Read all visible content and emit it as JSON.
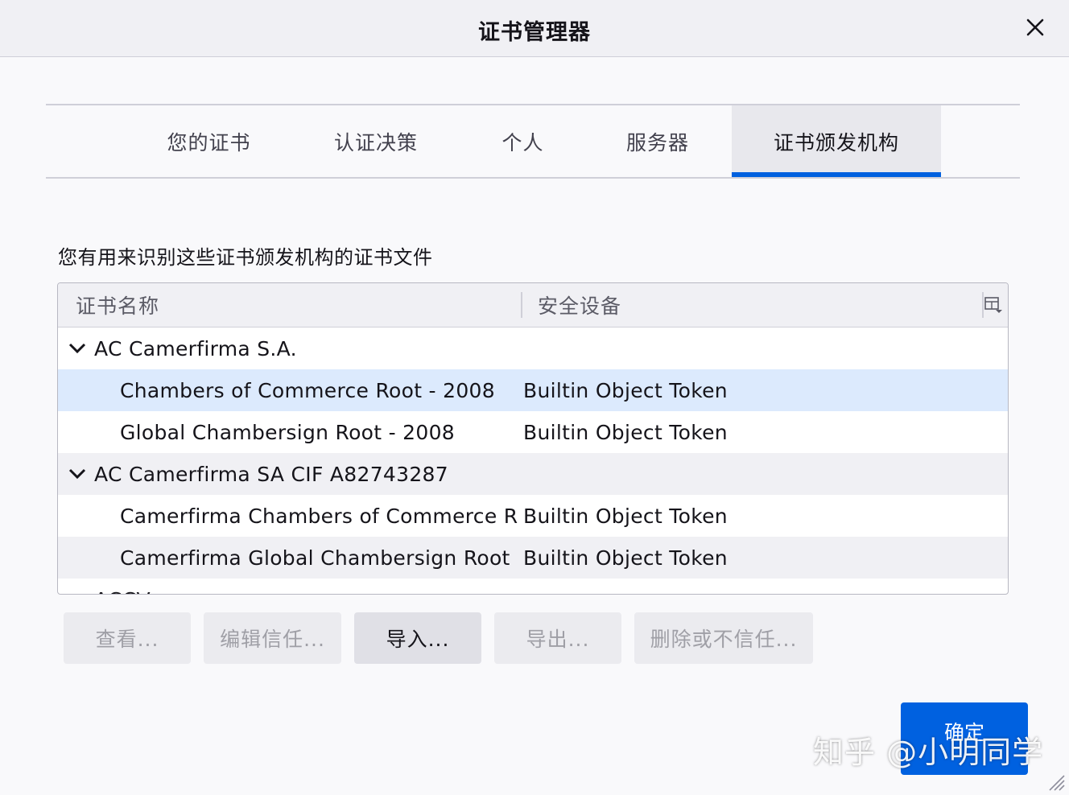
{
  "window": {
    "title": "证书管理器"
  },
  "tabs": [
    {
      "label": "您的证书"
    },
    {
      "label": "认证决策"
    },
    {
      "label": "个人"
    },
    {
      "label": "服务器"
    },
    {
      "label": "证书颁发机构",
      "active": true
    }
  ],
  "description": "您有用来识别这些证书颁发机构的证书文件",
  "tree": {
    "columns": [
      "证书名称",
      "安全设备"
    ],
    "rows": [
      {
        "name": "AC Camerfirma S.A.",
        "device": "",
        "group": true
      },
      {
        "name": "Chambers of Commerce Root - 2008",
        "device": "Builtin Object Token"
      },
      {
        "name": "Global Chambersign Root - 2008",
        "device": "Builtin Object Token"
      },
      {
        "name": "AC Camerfirma SA CIF A82743287",
        "device": "",
        "group": true
      },
      {
        "name": "Camerfirma Chambers of Commerce R...",
        "device": "Builtin Object Token"
      },
      {
        "name": "Camerfirma Global Chambersign Root",
        "device": "Builtin Object Token"
      },
      {
        "name": "ACCV",
        "device": "",
        "group": true
      }
    ]
  },
  "buttons": {
    "view": "查看...",
    "edit_trust": "编辑信任...",
    "import": "导入...",
    "export": "导出...",
    "delete": "删除或不信任..."
  },
  "ok_button": "确定",
  "watermark": "知乎 @小明同学",
  "colors": {
    "accent": "#0060df",
    "selected_row": "#dceafd"
  }
}
